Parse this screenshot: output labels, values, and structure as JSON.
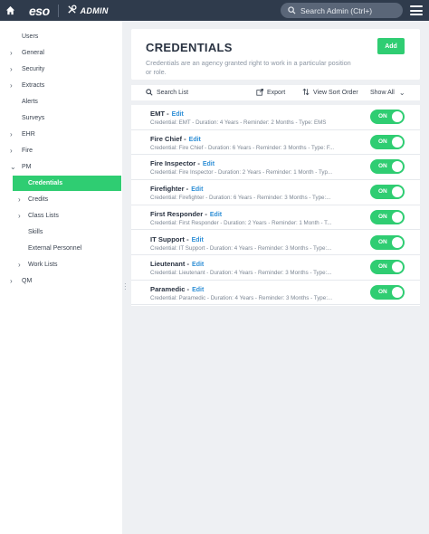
{
  "topbar": {
    "logo": "eso",
    "admin_label": "ADMIN",
    "search_placeholder": "Search Admin (Ctrl+)"
  },
  "sidebar": {
    "items": [
      {
        "label": "Users",
        "chevron": "",
        "indent": 1
      },
      {
        "label": "General",
        "chevron": "›",
        "indent": 0
      },
      {
        "label": "Security",
        "chevron": "›",
        "indent": 0
      },
      {
        "label": "Extracts",
        "chevron": "›",
        "indent": 0
      },
      {
        "label": "Alerts",
        "chevron": "",
        "indent": 1
      },
      {
        "label": "Surveys",
        "chevron": "",
        "indent": 1
      },
      {
        "label": "EHR",
        "chevron": "›",
        "indent": 0
      },
      {
        "label": "Fire",
        "chevron": "›",
        "indent": 0
      },
      {
        "label": "PM",
        "chevron": "⌄",
        "indent": 0
      }
    ],
    "active": "Credentials",
    "sub_items": [
      {
        "label": "Credits",
        "chevron": "›"
      },
      {
        "label": "Class Lists",
        "chevron": "›"
      },
      {
        "label": "Skills",
        "chevron": ""
      },
      {
        "label": "External Personnel",
        "chevron": ""
      },
      {
        "label": "Work Lists",
        "chevron": "›"
      }
    ],
    "last": {
      "label": "QM",
      "chevron": "›"
    }
  },
  "header": {
    "title": "CREDENTIALS",
    "description": "Credentials are an agency granted right to work in a particular position or role.",
    "add_label": "Add"
  },
  "toolbar": {
    "search": "Search List",
    "export": "Export",
    "view_sort": "View Sort Order",
    "show": "Show All"
  },
  "credentials": [
    {
      "name": "EMT -",
      "edit": "Edit",
      "detail": "Credential: EMT - Duration: 4 Years - Reminder: 2 Months - Type: EMS",
      "status": "ON"
    },
    {
      "name": "Fire Chief -",
      "edit": "Edit",
      "detail": "Credential: Fire Chief - Duration: 6 Years - Reminder: 3 Months - Type: F...",
      "status": "ON"
    },
    {
      "name": "Fire Inspector -",
      "edit": "Edit",
      "detail": "Credential: Fire Inspector - Duration: 2 Years - Reminder: 1 Month - Typ...",
      "status": "ON"
    },
    {
      "name": "Firefighter -",
      "edit": "Edit",
      "detail": "Credential: Firefighter - Duration: 6 Years - Reminder: 3 Months - Type:...",
      "status": "ON"
    },
    {
      "name": "First Responder -",
      "edit": "Edit",
      "detail": "Credential: First Responder - Duration: 2 Years - Reminder: 1 Month - T...",
      "status": "ON"
    },
    {
      "name": "IT Support -",
      "edit": "Edit",
      "detail": "Credential: IT Support - Duration: 4 Years - Reminder: 3 Months - Type:...",
      "status": "ON"
    },
    {
      "name": "Lieutenant -",
      "edit": "Edit",
      "detail": "Credential: Lieutenant - Duration: 4 Years - Reminder: 3 Months - Type:...",
      "status": "ON"
    },
    {
      "name": "Paramedic -",
      "edit": "Edit",
      "detail": "Credential: Paramedic - Duration: 4 Years - Reminder: 3 Months - Type:...",
      "status": "ON"
    }
  ],
  "colors": {
    "accent": "#2fcd72",
    "topbar": "#2f3b4c",
    "link": "#2f8fd6"
  }
}
